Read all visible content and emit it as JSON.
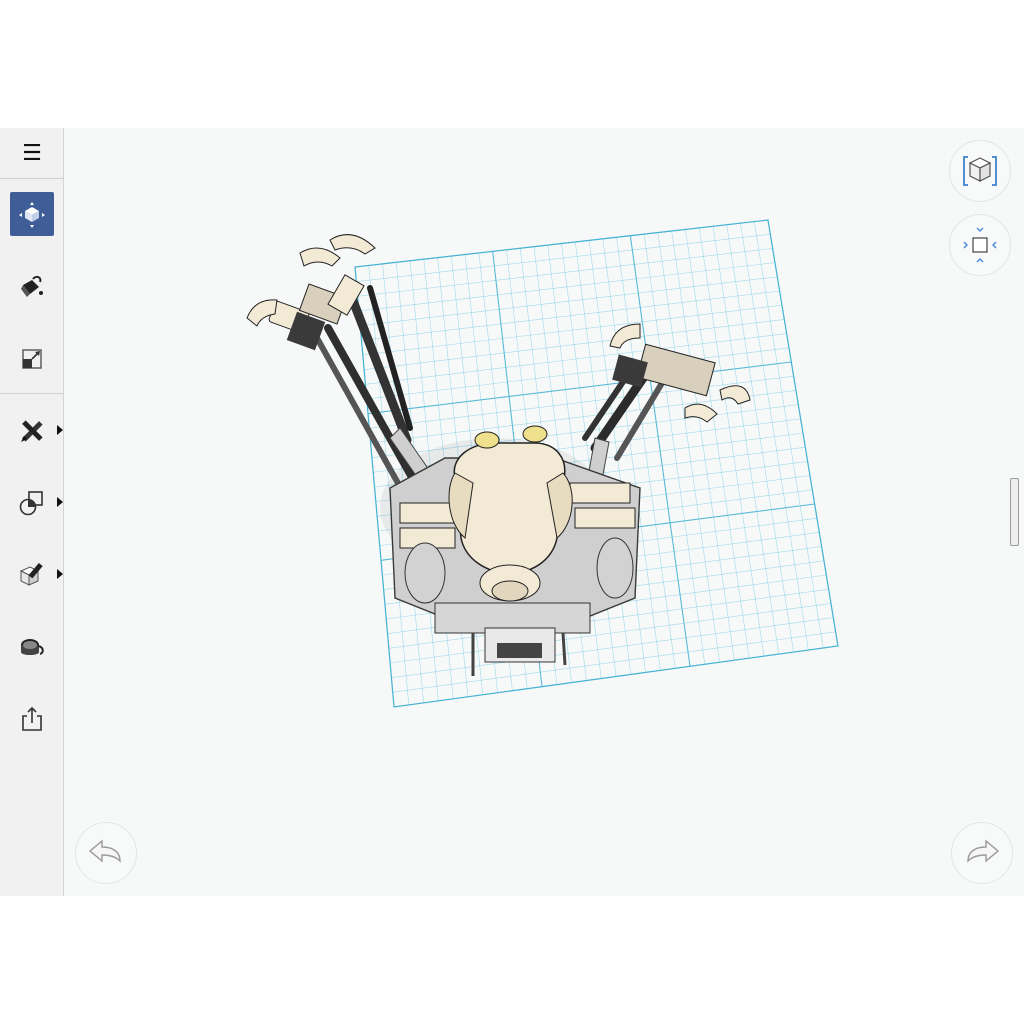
{
  "app": {
    "menu_glyph": "☰"
  },
  "toolbar": {
    "items": [
      {
        "id": "menu",
        "icon": "hamburger-icon"
      },
      {
        "id": "transform",
        "icon": "move-cube-icon",
        "active": true
      },
      {
        "id": "paint",
        "icon": "paint-bucket-icon"
      },
      {
        "id": "scale",
        "icon": "scale-icon"
      },
      {
        "id": "construct",
        "icon": "pencil-ruler-icon",
        "submenu": true
      },
      {
        "id": "primitives",
        "icon": "shapes-icon",
        "submenu": true
      },
      {
        "id": "modify",
        "icon": "edit-cube-icon",
        "submenu": true
      },
      {
        "id": "material",
        "icon": "material-bucket-icon"
      },
      {
        "id": "export",
        "icon": "share-icon"
      }
    ]
  },
  "colors": {
    "accent": "#3f5e97",
    "grid_line": "#5bc2de",
    "grid_major": "#47b3d4",
    "model_cream": "#f3ead6",
    "model_shadow": "#b9ae98",
    "model_dark": "#2b2b2b"
  },
  "viewcube": {
    "icon": "view-cube-icon"
  },
  "navigator": {
    "icon": "orbit-navigator-icon"
  },
  "undo": {
    "icon": "undo-arrow-icon"
  },
  "redo": {
    "icon": "redo-arrow-icon"
  }
}
